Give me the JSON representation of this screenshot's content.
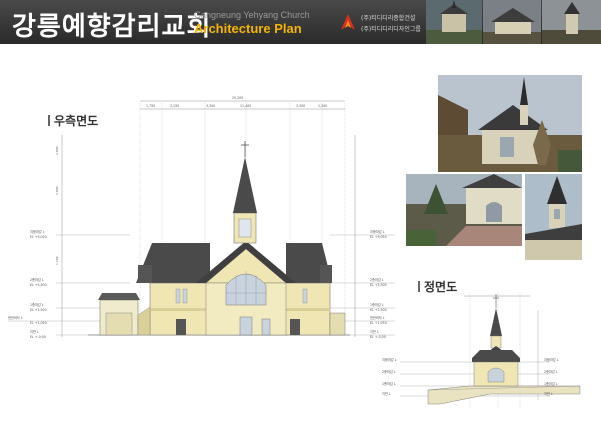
{
  "header": {
    "title_ko": "강릉예향감리교회",
    "title_en_small": "Gangneung Yehyang Church",
    "title_en_big": "Architecture Plan",
    "company_lines": [
      "(주)티디디리종합건설",
      "(주)티디디리디자인그룹"
    ]
  },
  "sections": {
    "right_elevation": "우측면도",
    "front_elevation": "정면도"
  },
  "dimensions": {
    "top_total": "25,200",
    "top_parts": [
      "1,750",
      "3,150",
      "3,300",
      "11,400",
      "3,300",
      "1,300"
    ],
    "left_levels": [
      {
        "label": "지붕마감 L",
        "sub": "EL +9,050"
      },
      {
        "label": "2층마감 L",
        "sub": "EL +5,500"
      },
      {
        "label": "1층마감 L",
        "sub": "EL +1,500"
      },
      {
        "label": "현관바닥 L",
        "sub": "EL +1,050"
      },
      {
        "label": "지반 L",
        "sub": "EL +-0,00"
      }
    ],
    "right_levels": [
      {
        "label": "지붕마감 L",
        "sub": "EL +9,050"
      },
      {
        "label": "2층마감 L",
        "sub": "EL +5,500"
      },
      {
        "label": "1층마감 L",
        "sub": "EL +1,500"
      },
      {
        "label": "현관바닥 L",
        "sub": "EL +1,050"
      },
      {
        "label": "지반 L",
        "sub": "EL +-0,00"
      }
    ],
    "side_labels": [
      "2,800",
      "3,800",
      "1,500"
    ]
  },
  "colors": {
    "header_bg": "#333333",
    "accent": "#f5b400",
    "logo_red": "#d6301e",
    "roof": "#4a4a4a",
    "wall": "#efe6b4",
    "window": "#c9d3de"
  }
}
